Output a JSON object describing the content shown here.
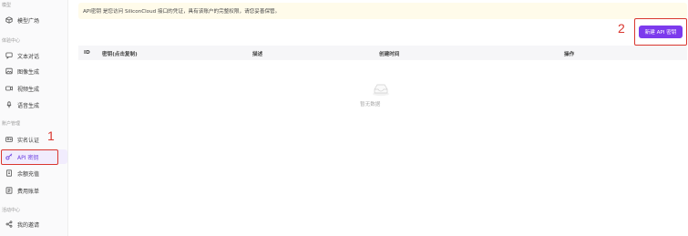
{
  "sidebar": {
    "top_section": "模型",
    "model_square": "模型广场",
    "experience_section": "体验中心",
    "text_chat": "文本对话",
    "image_gen": "图像生成",
    "video_gen": "视频生成",
    "voice_gen": "语音生成",
    "account_section": "账户管理",
    "realname": "实名认证",
    "api_keys": "API 密钥",
    "recharge": "余额充值",
    "billing": "费用账单",
    "activity_section": "活动中心",
    "invite": "我的邀请"
  },
  "notice": {
    "text": "API密钥 是您访问 SiliconCloud 接口的凭证，具有该账户的完整权限，请您妥善保管。"
  },
  "toolbar": {
    "new_key_label": "新建 API 密钥"
  },
  "table": {
    "columns": [
      "ID",
      "密钥(点击复制)",
      "描述",
      "创建时间",
      "操作"
    ]
  },
  "empty_state": {
    "text": "暂无数据"
  },
  "annotations": {
    "step1": "1",
    "step2": "2",
    "color": "#d9362f"
  },
  "colors": {
    "accent": "#7c3aed",
    "notice_bg": "#fffbea",
    "active_bg": "#f1ecfd"
  }
}
